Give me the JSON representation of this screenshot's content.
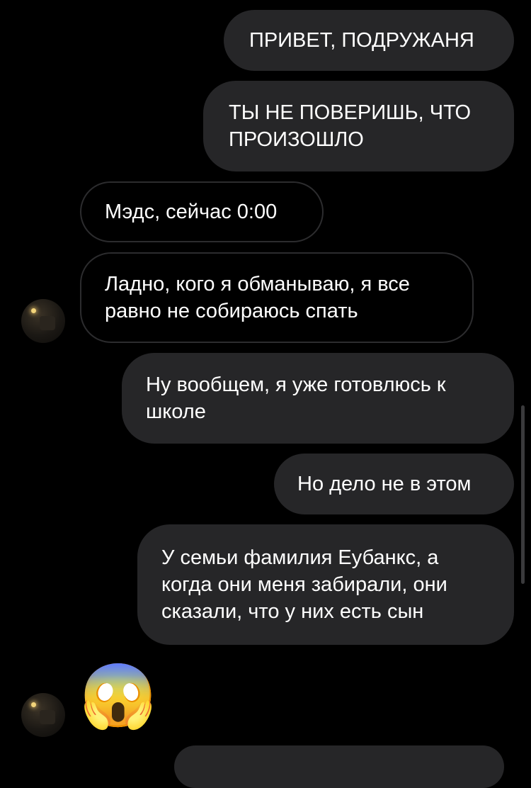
{
  "messages": [
    {
      "text": "ПРИВЕТ, ПОДРУЖАНЯ"
    },
    {
      "text": "ТЫ НЕ ПОВЕРИШЬ, ЧТО ПРОИЗОШЛО"
    },
    {
      "text": "Мэдс, сейчас 0:00"
    },
    {
      "text": "Ладно, кого я обманываю, я все равно не собираюсь спать"
    },
    {
      "text": "Ну вообщем, я уже готовлюсь к школе"
    },
    {
      "text": "Но дело не в этом"
    },
    {
      "text": "У семьи фамилия Еубанкс, а когда они меня забирали, они сказали, что у них есть сын"
    },
    {
      "text": "😱"
    }
  ],
  "colors": {
    "background": "#000000",
    "outgoing_bubble": "#262628",
    "incoming_border": "#2c2c2e",
    "text": "#ffffff"
  },
  "icons": {
    "avatar": "contact-avatar",
    "reaction": "face-screaming-in-fear-emoji"
  }
}
